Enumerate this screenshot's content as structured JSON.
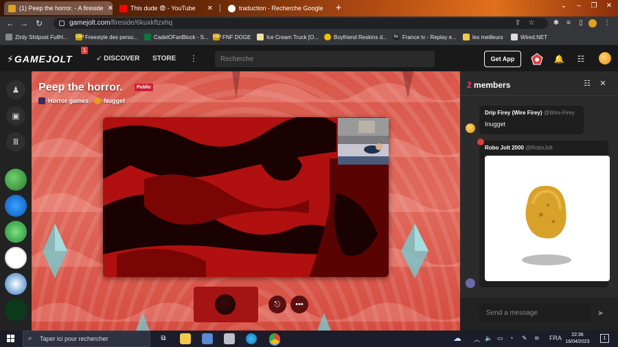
{
  "browser": {
    "tabs": [
      {
        "title": "(1) Peep the horror. - A fireside",
        "active": true,
        "fav_color": "#e0a020"
      },
      {
        "title": "This dude 😨 - YouTube",
        "active": false,
        "fav_color": "#ff0000"
      },
      {
        "title": "traduction - Recherche Google",
        "active": false,
        "fav_color": "#ffffff"
      }
    ],
    "new_tab": "+",
    "window_controls": [
      "⌄",
      "–",
      "❐",
      "✕"
    ],
    "url_host": "gamejolt.com",
    "url_path": "/fireside/6kuxkftzxhq",
    "bookmarks": [
      {
        "label": "Zirdy Shitpost FullH...",
        "fav_color": "#888888",
        "fav_text": ""
      },
      {
        "label": "Freestyle des perso...",
        "fav_color": "#c8a000",
        "fav_text": "KBH"
      },
      {
        "label": "CadelOFanBlock - S...",
        "fav_color": "#0a7a3a",
        "fav_text": ""
      },
      {
        "label": "FNF DOGE",
        "fav_color": "#c8a000",
        "fav_text": "KBH"
      },
      {
        "label": "Ice Cream Truck [O...",
        "fav_color": "#f0e0a0",
        "fav_text": ""
      },
      {
        "label": "Boyfriend Reskins d...",
        "fav_color": "#f0c000",
        "fav_text": ""
      },
      {
        "label": "France tv - Replay e...",
        "fav_color": "#222222",
        "fav_text": "ftv"
      },
      {
        "label": "les meilleurs",
        "fav_color": "#f2c94c",
        "fav_text": ""
      },
      {
        "label": "Wired.NET",
        "fav_color": "#dddddd",
        "fav_text": ""
      }
    ]
  },
  "gamejolt": {
    "logo": "GAMEJOLT",
    "notification_count": "1",
    "nav": {
      "discover": "DISCOVER",
      "store": "STORE"
    },
    "search_placeholder": "Recherche",
    "get_app": "Get App",
    "accent": "#ff3b77"
  },
  "fireside": {
    "title": "Peep the horror.",
    "badge": "Public",
    "community": "Horror games",
    "host": "Nugget"
  },
  "chat": {
    "member_count": "2",
    "member_label": "members",
    "messages": [
      {
        "author": "Drip Firey (Wire Firey)",
        "handle": "@Wire-Firey",
        "text": "Inugget"
      },
      {
        "author": "Robo Jolt 2000",
        "handle": "@RoboJolt",
        "text": ""
      }
    ],
    "compose_placeholder": "Send a message"
  },
  "taskbar": {
    "search_placeholder": "Taper ici pour rechercher",
    "language": "FRA",
    "time": "22:36",
    "date": "16/04/2023",
    "notification_count": "1"
  }
}
